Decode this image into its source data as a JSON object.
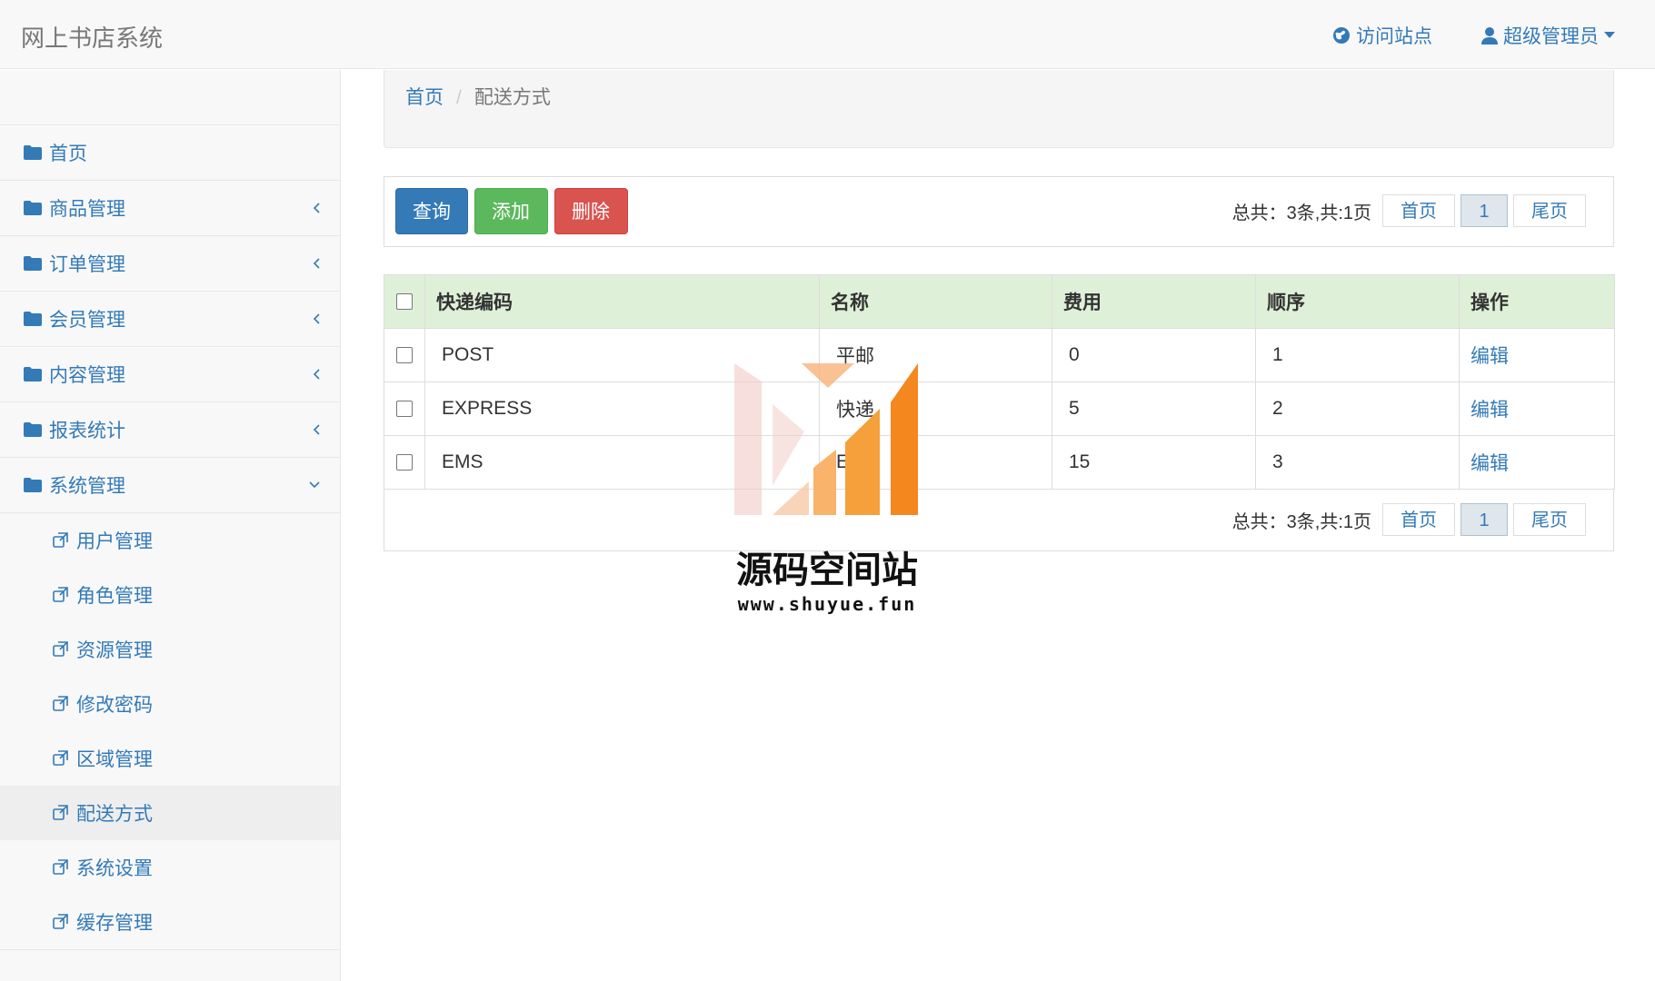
{
  "app": {
    "brand": "网上书店系统"
  },
  "topnav": {
    "visit_site": "访问站点",
    "admin_user": "超级管理员"
  },
  "sidebar": {
    "menus": [
      {
        "label": "首页",
        "expandable": false
      },
      {
        "label": "商品管理",
        "expandable": true
      },
      {
        "label": "订单管理",
        "expandable": true
      },
      {
        "label": "会员管理",
        "expandable": true
      },
      {
        "label": "内容管理",
        "expandable": true
      },
      {
        "label": "报表统计",
        "expandable": true
      },
      {
        "label": "系统管理",
        "expandable": true,
        "expanded": true
      }
    ],
    "submenu": [
      {
        "label": "用户管理"
      },
      {
        "label": "角色管理"
      },
      {
        "label": "资源管理"
      },
      {
        "label": "修改密码"
      },
      {
        "label": "区域管理"
      },
      {
        "label": "配送方式",
        "active": true
      },
      {
        "label": "系统设置"
      },
      {
        "label": "缓存管理"
      }
    ]
  },
  "breadcrumb": {
    "home": "首页",
    "current": "配送方式"
  },
  "toolbar": {
    "query": "查询",
    "add": "添加",
    "delete": "删除"
  },
  "pagination": {
    "summary": "总共：3条,共:1页",
    "first": "首页",
    "current_page": "1",
    "last": "尾页"
  },
  "table": {
    "headers": [
      "快递编码",
      "名称",
      "费用",
      "顺序",
      "操作"
    ],
    "rows": [
      {
        "code": "POST",
        "name": "平邮",
        "fee": "0",
        "order": "1",
        "action": "编辑"
      },
      {
        "code": "EXPRESS",
        "name": "快递",
        "fee": "5",
        "order": "2",
        "action": "编辑"
      },
      {
        "code": "EMS",
        "name": "EMS",
        "fee": "15",
        "order": "3",
        "action": "编辑"
      }
    ]
  },
  "watermark": {
    "title": "源码空间站",
    "url": "www.shuyue.fun"
  },
  "colors": {
    "primary": "#337ab7",
    "success": "#5cb85c",
    "danger": "#d9534f",
    "table_header": "#dff0d8",
    "accent_orange": "#f5871f"
  },
  "icons": {
    "globe": "globe-icon",
    "user": "user-icon",
    "caret": "caret-down-icon",
    "folder": "folder-icon",
    "chevron_left": "chevron-left-icon",
    "chevron_down": "chevron-down-icon",
    "external": "external-link-icon"
  }
}
